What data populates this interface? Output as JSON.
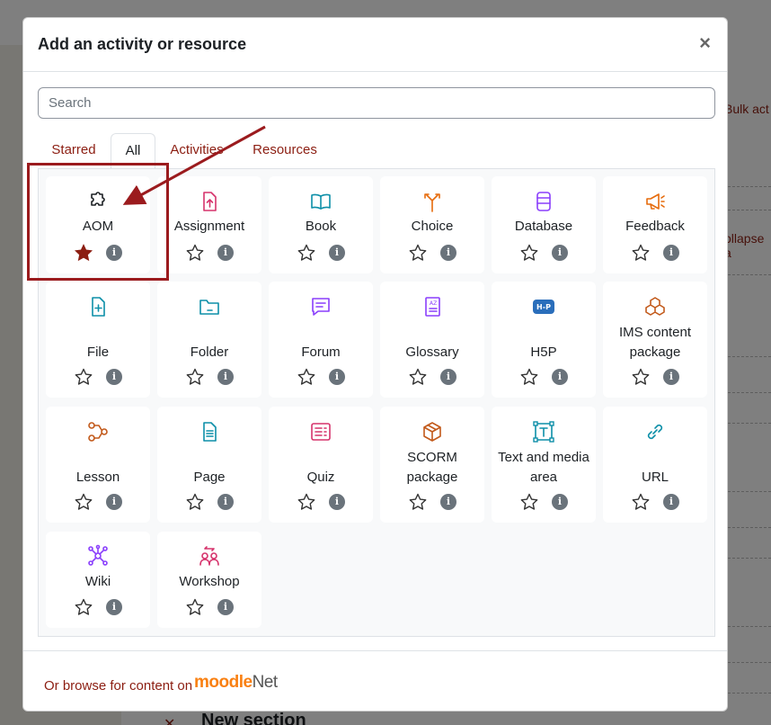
{
  "background": {
    "bulk_text": "Bulk act",
    "collapse_text": "ollapse a",
    "section_title": "New section"
  },
  "modal": {
    "title": "Add an activity or resource",
    "close_label": "×",
    "search": {
      "placeholder": "Search",
      "value": ""
    },
    "tabs": [
      {
        "label": "Starred",
        "active": false
      },
      {
        "label": "All",
        "active": true
      },
      {
        "label": "Activities",
        "active": false
      },
      {
        "label": "Resources",
        "active": false
      }
    ],
    "activities": [
      {
        "name": "AOM",
        "icon": "puzzle-icon",
        "color": "#1d2125",
        "starred": true
      },
      {
        "name": "Assignment",
        "icon": "assignment-icon",
        "color": "#d6336c",
        "starred": false
      },
      {
        "name": "Book",
        "icon": "book-icon",
        "color": "#0d8fa8",
        "starred": false
      },
      {
        "name": "Choice",
        "icon": "choice-icon",
        "color": "#e66b0c",
        "starred": false
      },
      {
        "name": "Database",
        "icon": "database-icon",
        "color": "#8a3ffc",
        "starred": false
      },
      {
        "name": "Feedback",
        "icon": "megaphone-icon",
        "color": "#e66b0c",
        "starred": false
      },
      {
        "name": "File",
        "icon": "file-icon",
        "color": "#0d8fa8",
        "starred": false
      },
      {
        "name": "Folder",
        "icon": "folder-icon",
        "color": "#0d8fa8",
        "starred": false
      },
      {
        "name": "Forum",
        "icon": "forum-icon",
        "color": "#8a3ffc",
        "starred": false
      },
      {
        "name": "Glossary",
        "icon": "glossary-icon",
        "color": "#8a3ffc",
        "starred": false
      },
      {
        "name": "H5P",
        "icon": "h5p-icon",
        "color": "#2a6ebb",
        "starred": false
      },
      {
        "name": "IMS content package",
        "icon": "cubes-icon",
        "color": "#c2591a",
        "starred": false
      },
      {
        "name": "Lesson",
        "icon": "lesson-icon",
        "color": "#c2591a",
        "starred": false
      },
      {
        "name": "Page",
        "icon": "page-icon",
        "color": "#0d8fa8",
        "starred": false
      },
      {
        "name": "Quiz",
        "icon": "quiz-icon",
        "color": "#d6336c",
        "starred": false
      },
      {
        "name": "SCORM package",
        "icon": "box-icon",
        "color": "#c2591a",
        "starred": false
      },
      {
        "name": "Text and media area",
        "icon": "text-frame-icon",
        "color": "#0d8fa8",
        "starred": false
      },
      {
        "name": "URL",
        "icon": "link-icon",
        "color": "#0d8fa8",
        "starred": false
      },
      {
        "name": "Wiki",
        "icon": "wiki-icon",
        "color": "#8a3ffc",
        "starred": false
      },
      {
        "name": "Workshop",
        "icon": "workshop-icon",
        "color": "#d6336c",
        "starred": false
      }
    ],
    "footer": {
      "browse_text": "Or browse for content on",
      "logo_moodle": "moodle",
      "logo_net": "Net"
    }
  },
  "colors": {
    "accent": "#8c1e12",
    "annotation": "#9b1b1e",
    "star_filled": "#8c1e12",
    "info": "#6a737b"
  }
}
